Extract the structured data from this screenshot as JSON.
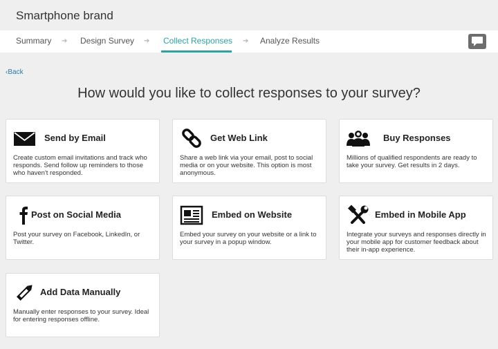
{
  "header": {
    "brand": "Smartphone brand"
  },
  "nav": {
    "steps": [
      {
        "label": "Summary"
      },
      {
        "label": "Design Survey"
      },
      {
        "label": "Collect Responses"
      },
      {
        "label": "Analyze Results"
      }
    ],
    "active_index": 2,
    "arrow_glyph": "➔",
    "accent_color": "#2aa3a3"
  },
  "feedback_button": {
    "icon": "chat-bubble-icon"
  },
  "back_link": {
    "label": "Back",
    "icon": "chevron-left-icon"
  },
  "headline": "How would you like to collect responses to your survey?",
  "options": [
    {
      "icon": "envelope-icon",
      "title": "Send by Email",
      "description": "Create custom email invitations and track who responds. Send follow up reminders to those who haven't responded."
    },
    {
      "icon": "link-icon",
      "title": "Get Web Link",
      "description": "Share a web link via your email, post to social media or on your website. This option is most anonymous."
    },
    {
      "icon": "people-icon",
      "title": "Buy Responses",
      "description": "Millions of qualified respondents are ready to take your survey. Get results in 2 days."
    },
    {
      "icon": "facebook-icon",
      "title": "Post on Social Media",
      "description": "Post your survey on Facebook, LinkedIn, or Twitter."
    },
    {
      "icon": "newspaper-icon",
      "title": "Embed on Website",
      "description": "Embed your survey on your website or a link to your survey in a popup window."
    },
    {
      "icon": "tools-icon",
      "title": "Embed in Mobile App",
      "description": "Integrate your surveys and responses directly in your mobile app for customer feedback about their in-app experience."
    },
    {
      "icon": "pencil-icon",
      "title": "Add Data Manually",
      "description": "Manually enter responses to your survey. Ideal for entering responses offline."
    }
  ]
}
